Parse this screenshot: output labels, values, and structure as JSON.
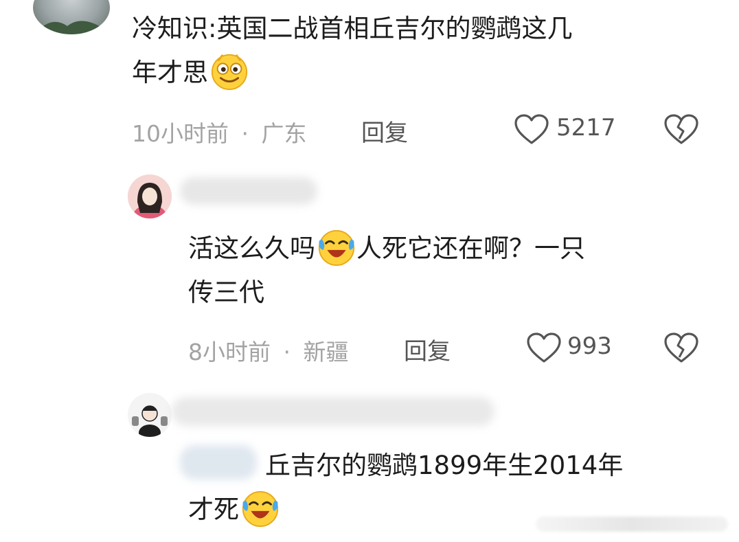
{
  "comments": [
    {
      "text_a": "冷知识:英国二战首相丘吉尔的鹦鹉这几",
      "text_b": "年才思",
      "emoji": "smiling-face-icon",
      "time": "10小时前",
      "location": "广东",
      "reply_label": "回复",
      "likes": "5217"
    },
    {
      "text_a": "活这么久吗",
      "emoji": "crying-laughing-face-icon",
      "text_b": "人死它还在啊？一只",
      "text_c": "传三代",
      "time": "8小时前",
      "location": "新疆",
      "reply_label": "回复",
      "likes": "993"
    },
    {
      "text_a": "丘吉尔的鹦鹉1899年生2014年",
      "text_b": "才死",
      "emoji": "crying-laughing-face-icon"
    }
  ],
  "meta_separator": "·",
  "colors": {
    "meta_gray": "#a3a3a3",
    "text": "#1c1c1c",
    "icon": "#555555"
  }
}
